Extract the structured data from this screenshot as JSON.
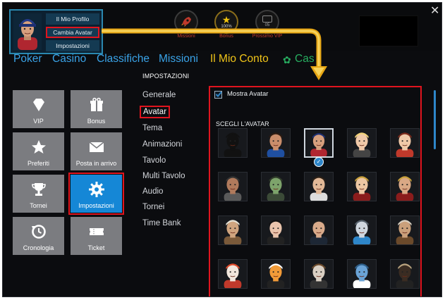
{
  "profile_menu": {
    "items": [
      "Il Mio Profilo",
      "Cambia Avatar",
      "Impostazioni"
    ]
  },
  "top_stats": [
    {
      "icon": "rocket-icon",
      "caption": "Missioni"
    },
    {
      "icon": "star-icon",
      "value": "100%",
      "caption": "Bonus"
    },
    {
      "icon": "vip-badge-icon",
      "value": "05",
      "caption": "Prossimo VIP"
    }
  ],
  "nav": {
    "items": [
      "Poker",
      "Casino",
      "Classifiche",
      "Missioni",
      "Il Mio Conto",
      "Cas"
    ]
  },
  "tiles": [
    {
      "label": "VIP",
      "icon": "diamond-icon"
    },
    {
      "label": "Bonus",
      "icon": "gift-icon"
    },
    {
      "label": "Preferiti",
      "icon": "star-icon"
    },
    {
      "label": "Posta in arrivo",
      "icon": "mail-icon"
    },
    {
      "label": "Tornei",
      "icon": "trophy-icon"
    },
    {
      "label": "Impostazioni",
      "icon": "gear-icon"
    },
    {
      "label": "Cronologia",
      "icon": "history-icon"
    },
    {
      "label": "Ticket",
      "icon": "ticket-icon"
    }
  ],
  "settings": {
    "title": "IMPOSTAZIONI",
    "menu": [
      "Generale",
      "Avatar",
      "Tema",
      "Animazioni",
      "Tavolo",
      "Multi Tavolo",
      "Audio",
      "Tornei",
      "Time Bank"
    ],
    "selected": "Avatar"
  },
  "avatar_panel": {
    "show_avatar_label": "Mostra Avatar",
    "show_avatar_checked": true,
    "section_title": "SCEGLI L'AVATAR",
    "selected_index": 2
  },
  "colors": {
    "accent_blue": "#3aa3e8",
    "highlight_red": "#e0141e",
    "tile_grey": "#7b7c80",
    "tile_selected": "#1587d6",
    "arrow": "#f5b01a"
  }
}
